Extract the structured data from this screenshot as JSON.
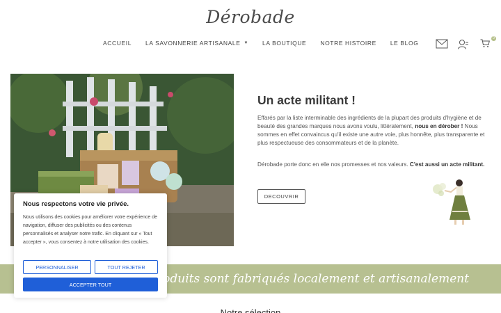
{
  "brand": {
    "logo": "Dérobade"
  },
  "nav": {
    "items": [
      {
        "label": "ACCUEIL"
      },
      {
        "label": "LA SAVONNERIE ARTISANALE",
        "dropdown": true
      },
      {
        "label": "LA BOUTIQUE"
      },
      {
        "label": "NOTRE HISTOIRE"
      },
      {
        "label": "LE BLOG"
      }
    ],
    "icons": [
      "mail-icon",
      "account-icon",
      "cart-icon"
    ],
    "cart_count": "0"
  },
  "hero": {
    "title": "Un acte militant !",
    "para1_a": "Effarés par la liste interminable des ingrédients de la plupart des produits d'hygiène et de beauté des grandes marques nous avons voulu, littéralement, ",
    "para1_b": "nous en dérober !",
    "para1_c": " Nous sommes en effet convaincus qu'il existe une autre voie, plus honnête, plus transparente et plus respectueuse des consommateurs et de la planète.",
    "para2_a": "Dérobade porte donc en elle nos promesses et nos valeurs. ",
    "para2_b": "C'est aussi un acte militant.",
    "button": "DECOUVRIR"
  },
  "banner": {
    "text": "Nos produits sont fabriqués localement et artisanalement"
  },
  "section": {
    "title": "Notre sélection"
  },
  "cookie": {
    "title": "Nous respectons votre vie privée.",
    "body": "Nous utilisons des cookies pour améliorer votre expérience de navigation, diffuser des publicités ou des contenus personnalisés et analyser notre trafic. En cliquant sur « Tout accepter », vous consentez à notre utilisation des cookies.",
    "customize": "PERSONNALISER",
    "reject": "TOUT REJETER",
    "accept": "ACCEPTER TOUT"
  },
  "colors": {
    "accent_green": "#b7c091",
    "cookie_blue": "#1f5fd8"
  }
}
